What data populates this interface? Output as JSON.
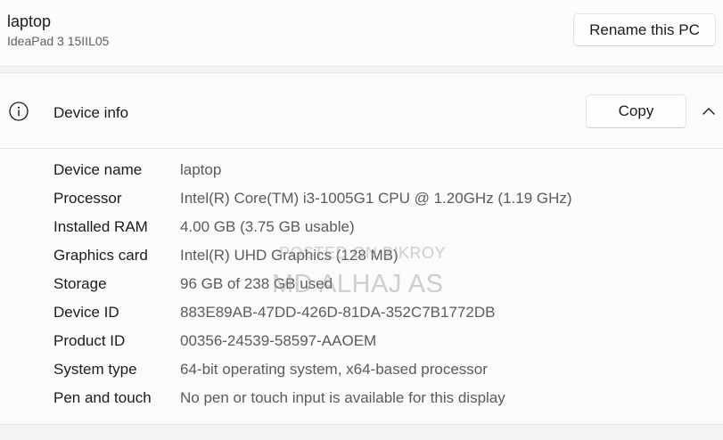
{
  "pc": {
    "name": "laptop",
    "model": "IdeaPad 3 15IIL05",
    "rename_label": "Rename this PC"
  },
  "device_info": {
    "title": "Device info",
    "copy_label": "Copy",
    "icons": {
      "info": "info-icon",
      "collapse": "chevron-up-icon"
    },
    "specs": [
      {
        "label": "Device name",
        "value": "laptop"
      },
      {
        "label": "Processor",
        "value": "Intel(R) Core(TM) i3-1005G1 CPU @ 1.20GHz (1.19 GHz)"
      },
      {
        "label": "Installed RAM",
        "value": "4.00 GB (3.75 GB usable)"
      },
      {
        "label": "Graphics card",
        "value": "Intel(R) UHD Graphics (128 MB)"
      },
      {
        "label": "Storage",
        "value": "96 GB of 238 GB used"
      },
      {
        "label": "Device ID",
        "value": "883E89AB-47DD-426D-81DA-352C7B1772DB"
      },
      {
        "label": "Product ID",
        "value": "00356-24539-58597-AAOEM"
      },
      {
        "label": "System type",
        "value": "64-bit operating system, x64-based processor"
      },
      {
        "label": "Pen and touch",
        "value": "No pen or touch input is available for this display"
      }
    ]
  },
  "watermark": {
    "line1": "POSTED ON BIKROY",
    "line2": "MD ALHAJ AS"
  }
}
